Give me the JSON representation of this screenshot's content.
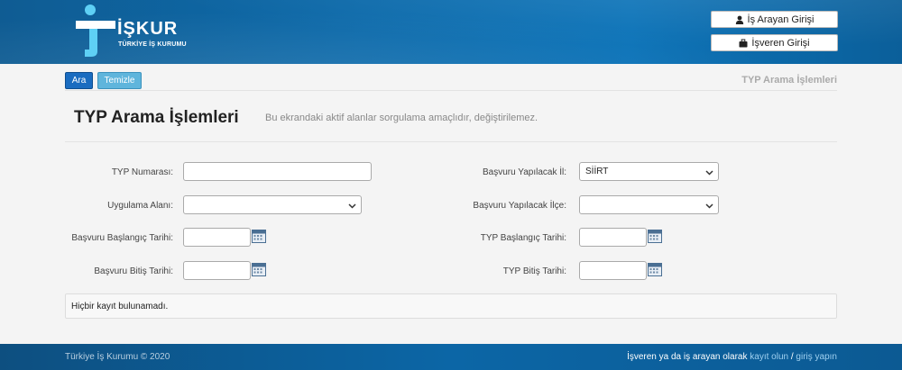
{
  "brand": {
    "name": "İŞKUR",
    "subtitle": "TÜRKİYE İŞ KURUMU",
    "color": "#0e6bab"
  },
  "header": {
    "job_seeker_login": "İş Arayan Girişi",
    "employer_login": "İşveren Girişi",
    "job_seeker_icon": "user-icon",
    "employer_icon": "briefcase-icon"
  },
  "toolbar": {
    "search_label": "Ara",
    "clear_label": "Temizle",
    "section_title": "TYP Arama İşlemleri"
  },
  "page": {
    "title": "TYP Arama İşlemleri",
    "subtitle": "Bu ekrandaki aktif alanlar sorgulama amaçlıdır, değiştirilemez."
  },
  "form": {
    "typ_number_label": "TYP Numarası:",
    "typ_number_value": "",
    "application_area_label": "Uygulama Alanı:",
    "application_area_value": "",
    "application_start_label": "Başvuru Başlangıç Tarihi:",
    "application_start_value": "",
    "application_end_label": "Başvuru Bitiş Tarihi:",
    "application_end_value": "",
    "apply_province_label": "Başvuru Yapılacak İl:",
    "apply_province_value": "SİİRT",
    "apply_district_label": "Başvuru Yapılacak İlçe:",
    "apply_district_value": "",
    "typ_start_label": "TYP Başlangıç Tarihi:",
    "typ_start_value": "",
    "typ_end_label": "TYP Bitiş Tarihi:",
    "typ_end_value": ""
  },
  "result": {
    "message": "Hiçbir kayıt bulunamadı."
  },
  "footer": {
    "copyright": "Türkiye İş Kurumu © 2020",
    "prompt": "İşveren ya da iş arayan olarak",
    "register": "kayıt olun",
    "separator": "/",
    "login": "giriş yapın"
  }
}
